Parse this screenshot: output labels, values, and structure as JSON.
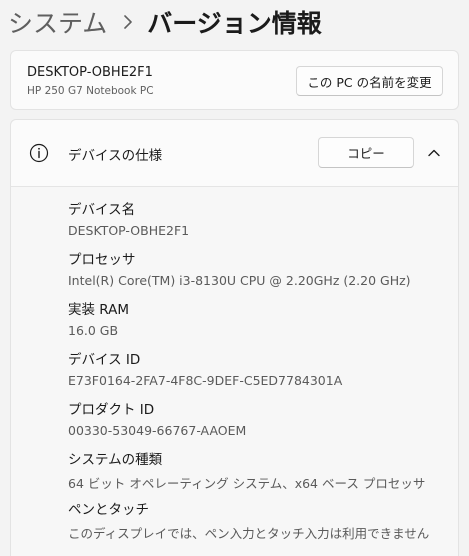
{
  "breadcrumb": {
    "parent": "システム",
    "current": "バージョン情報"
  },
  "device": {
    "name": "DESKTOP-OBHE2F1",
    "model": "HP 250 G7 Notebook PC",
    "rename_button": "この PC の名前を変更"
  },
  "spec": {
    "title": "デバイスの仕様",
    "copy_button": "コピー",
    "items": [
      {
        "label": "デバイス名",
        "value": "DESKTOP-OBHE2F1"
      },
      {
        "label": "プロセッサ",
        "value": "Intel(R) Core(TM) i3-8130U CPU @ 2.20GHz (2.20 GHz)"
      },
      {
        "label": "実装 RAM",
        "value": "16.0 GB"
      },
      {
        "label": "デバイス ID",
        "value": "E73F0164-2FA7-4F8C-9DEF-C5ED7784301A"
      },
      {
        "label": "プロダクト ID",
        "value": "00330-53049-66767-AAOEM"
      },
      {
        "label": "システムの種類",
        "value": "64 ビット オペレーティング システム、x64 ベース プロセッサ"
      },
      {
        "label": "ペンとタッチ",
        "value": "このディスプレイでは、ペン入力とタッチ入力は利用できません"
      }
    ]
  },
  "icons": {
    "breadcrumb_separator": "chevron-right-icon",
    "spec_info": "info-icon",
    "spec_toggle": "chevron-up-icon"
  }
}
